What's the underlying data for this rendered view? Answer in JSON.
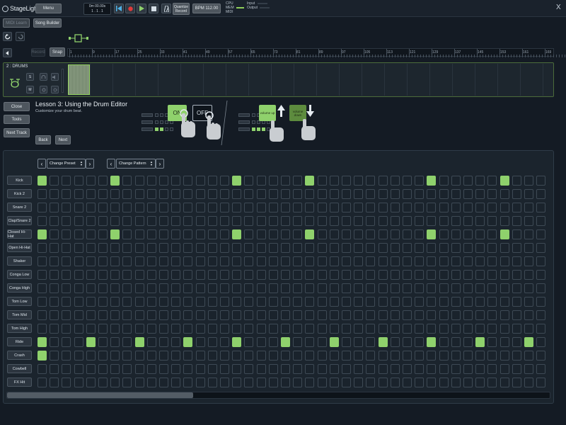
{
  "app": {
    "logo": "StageLight"
  },
  "topbar": {
    "menu": "Menu",
    "time_line1": "0m  00.00s",
    "time_line2": "1 . 1 . 1",
    "quantize_line1": "Quantize",
    "quantize_line2": "Record",
    "bpm": "BPM 112.00",
    "meters": [
      "CPU",
      "MEM",
      "MIDI"
    ],
    "io": [
      "Input",
      "Output"
    ],
    "close": "X"
  },
  "secondrow": {
    "midi_learn": "MIDI Learn",
    "song_builder": "Song Builder"
  },
  "ruler": {
    "record": "Record",
    "snap": "Snap",
    "ticks": [
      "1",
      "9",
      "17",
      "25",
      "33",
      "41",
      "49",
      "57",
      "65",
      "73",
      "81",
      "89",
      "97",
      "105",
      "113",
      "121",
      "129",
      "137",
      "145",
      "153",
      "161",
      "169"
    ]
  },
  "track": {
    "name": "2 : DRUMS",
    "solo": "S",
    "mute": "M"
  },
  "lesson": {
    "title": "Lesson 3: Using the Drum Editor",
    "subtitle": "Customize your drum beat.",
    "back": "Back",
    "next": "Next",
    "close": "Close",
    "tools": "Tools",
    "next_track": "Next Track",
    "on": "ON",
    "off": "OFF",
    "volume_up": "volume up",
    "volume_down": "volume down"
  },
  "editor": {
    "preset": "Change Preset",
    "pattern": "Change Pattern",
    "instruments": [
      "Kick",
      "Kick 2",
      "Snare 2",
      "Clap/Snare 2",
      "Closed Hi-Hat",
      "Open Hi-Hat",
      "Shaker",
      "Conga Low",
      "Conga High",
      "Tom Low",
      "Tom Mid",
      "Tom High",
      "Ride",
      "Crash",
      "Cowbell",
      "FX Hit"
    ],
    "steps": 42,
    "active": {
      "0": [
        0,
        6,
        16,
        22,
        32,
        38
      ],
      "4": [
        0,
        6,
        16,
        22,
        32,
        38
      ],
      "12": [
        0,
        4,
        8,
        12,
        16,
        20,
        24,
        28,
        32,
        36,
        40
      ],
      "13": [
        0
      ]
    }
  },
  "colors": {
    "accent": "#8fd16c",
    "background": "#141b24"
  }
}
